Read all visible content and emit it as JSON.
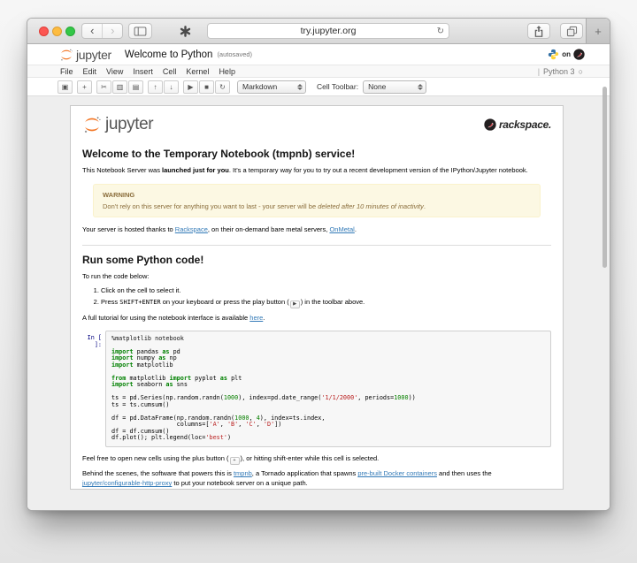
{
  "colors": {
    "jupyter_orange": "#f37726",
    "link_blue": "#337ab7",
    "warning_bg": "#fcf8e3",
    "warning_text": "#8a6d3b",
    "keyword_green": "#008000",
    "string_red": "#ba2121"
  },
  "browser": {
    "url": "try.jupyter.org",
    "back_glyph": "‹",
    "forward_glyph": "›",
    "reload_glyph": "↻",
    "new_tab_glyph": "+"
  },
  "app": {
    "logo_word": "jupyter",
    "title": "Welcome to Python",
    "autosaved": "(autosaved)",
    "on_label": "on",
    "menu": [
      "File",
      "Edit",
      "View",
      "Insert",
      "Cell",
      "Kernel",
      "Help"
    ],
    "kernel_sep": "|",
    "kernel_name": "Python 3",
    "kernel_idle_glyph": "○",
    "toolbar": {
      "groups": [
        [
          {
            "name": "save",
            "glyph": "▣"
          }
        ],
        [
          {
            "name": "add-cell",
            "glyph": "+"
          }
        ],
        [
          {
            "name": "cut-cell",
            "glyph": "✂"
          },
          {
            "name": "copy-cell",
            "glyph": "▥"
          },
          {
            "name": "paste-cell",
            "glyph": "▤"
          }
        ],
        [
          {
            "name": "move-cell-up",
            "glyph": "↑"
          },
          {
            "name": "move-cell-down",
            "glyph": "↓"
          }
        ],
        [
          {
            "name": "run-cell",
            "glyph": "▶"
          },
          {
            "name": "interrupt-kernel",
            "glyph": "■"
          },
          {
            "name": "restart-kernel",
            "glyph": "↻"
          }
        ]
      ],
      "cell_type_value": "Markdown",
      "cell_toolbar_label": "Cell Toolbar:",
      "cell_toolbar_value": "None"
    }
  },
  "notebook": {
    "brand_jupyter": "jupyter",
    "brand_rackspace": "rackspace.",
    "welcome_heading": "Welcome to the Temporary Notebook (tmpnb) service!",
    "welcome_para": [
      {
        "t": "This Notebook Server was "
      },
      {
        "t": "launched just for you",
        "s": "b"
      },
      {
        "t": ". It's a temporary way for you to try out a recent development version of the IPython/Jupyter notebook."
      }
    ],
    "warning_title": "WARNING",
    "warning_body": [
      {
        "t": "Don't rely on this server for anything you want to last - your server will be "
      },
      {
        "t": "deleted after 10 minutes of inactivity",
        "s": "i"
      },
      {
        "t": "."
      }
    ],
    "hosted_para": [
      {
        "t": "Your server is hosted thanks to "
      },
      {
        "t": "Rackspace",
        "s": "link"
      },
      {
        "t": ", on their on-demand bare metal servers, "
      },
      {
        "t": "OnMetal",
        "s": "link"
      },
      {
        "t": "."
      }
    ],
    "run_heading": "Run some Python code!",
    "run_intro": "To run the code below:",
    "steps": [
      [
        {
          "t": "Click on the cell to select it."
        }
      ],
      [
        {
          "t": "Press "
        },
        {
          "t": "SHIFT+ENTER",
          "s": "code"
        },
        {
          "t": " on your keyboard or press the play button ("
        },
        {
          "t": "▶",
          "s": "btn",
          "n": "play-button-icon"
        },
        {
          "t": ") in the toolbar above."
        }
      ]
    ],
    "tutorial_para": [
      {
        "t": "A full tutorial for using the notebook interface is available "
      },
      {
        "t": "here",
        "s": "link"
      },
      {
        "t": "."
      }
    ],
    "cell_prompt": "In [ ]:",
    "code_lines": [
      [
        {
          "t": "%matplotlib notebook",
          "c": "m"
        }
      ],
      [],
      [
        {
          "t": "import",
          "c": "k"
        },
        {
          "t": " pandas ",
          "c": "p"
        },
        {
          "t": "as",
          "c": "k"
        },
        {
          "t": " pd",
          "c": "p"
        }
      ],
      [
        {
          "t": "import",
          "c": "k"
        },
        {
          "t": " numpy ",
          "c": "p"
        },
        {
          "t": "as",
          "c": "k"
        },
        {
          "t": " np",
          "c": "p"
        }
      ],
      [
        {
          "t": "import",
          "c": "k"
        },
        {
          "t": " matplotlib",
          "c": "p"
        }
      ],
      [],
      [
        {
          "t": "from",
          "c": "k"
        },
        {
          "t": " matplotlib ",
          "c": "p"
        },
        {
          "t": "import",
          "c": "k"
        },
        {
          "t": " pyplot ",
          "c": "p"
        },
        {
          "t": "as",
          "c": "k"
        },
        {
          "t": " plt",
          "c": "p"
        }
      ],
      [
        {
          "t": "import",
          "c": "k"
        },
        {
          "t": " seaborn ",
          "c": "p"
        },
        {
          "t": "as",
          "c": "k"
        },
        {
          "t": " sns",
          "c": "p"
        }
      ],
      [],
      [
        {
          "t": "ts = pd.Series(np.random.randn(",
          "c": "p"
        },
        {
          "t": "1000",
          "c": "n"
        },
        {
          "t": "), index=pd.date_range(",
          "c": "p"
        },
        {
          "t": "'1/1/2000'",
          "c": "s"
        },
        {
          "t": ", periods=",
          "c": "p"
        },
        {
          "t": "1000",
          "c": "n"
        },
        {
          "t": "))",
          "c": "p"
        }
      ],
      [
        {
          "t": "ts = ts.cumsum()",
          "c": "p"
        }
      ],
      [],
      [
        {
          "t": "df = pd.DataFrame(np.random.randn(",
          "c": "p"
        },
        {
          "t": "1000",
          "c": "n"
        },
        {
          "t": ", ",
          "c": "p"
        },
        {
          "t": "4",
          "c": "n"
        },
        {
          "t": "), index=ts.index,",
          "c": "p"
        }
      ],
      [
        {
          "t": "                  columns=[",
          "c": "p"
        },
        {
          "t": "'A'",
          "c": "s"
        },
        {
          "t": ", ",
          "c": "p"
        },
        {
          "t": "'B'",
          "c": "s"
        },
        {
          "t": ", ",
          "c": "p"
        },
        {
          "t": "'C'",
          "c": "s"
        },
        {
          "t": ", ",
          "c": "p"
        },
        {
          "t": "'D'",
          "c": "s"
        },
        {
          "t": "])",
          "c": "p"
        }
      ],
      [
        {
          "t": "df = df.cumsum()",
          "c": "p"
        }
      ],
      [
        {
          "t": "df.plot(); plt.legend(loc=",
          "c": "p"
        },
        {
          "t": "'best'",
          "c": "s"
        },
        {
          "t": ")",
          "c": "p"
        }
      ]
    ],
    "feel_free_para": [
      {
        "t": "Feel free to open new cells using the plus button ("
      },
      {
        "t": "+",
        "s": "btn",
        "n": "plus-button-icon"
      },
      {
        "t": "), or hitting shift-enter while this cell is selected."
      }
    ],
    "behind_para": [
      {
        "t": "Behind the scenes, the software that powers this is "
      },
      {
        "t": "tmpnb",
        "s": "link"
      },
      {
        "t": ", a Tornado application that spawns "
      },
      {
        "t": "pre-built Docker containers",
        "s": "link"
      },
      {
        "t": " and then uses the "
      },
      {
        "t": "jupyter/configurable-http-proxy",
        "s": "link"
      },
      {
        "t": " to put your notebook server on a unique path."
      }
    ]
  }
}
